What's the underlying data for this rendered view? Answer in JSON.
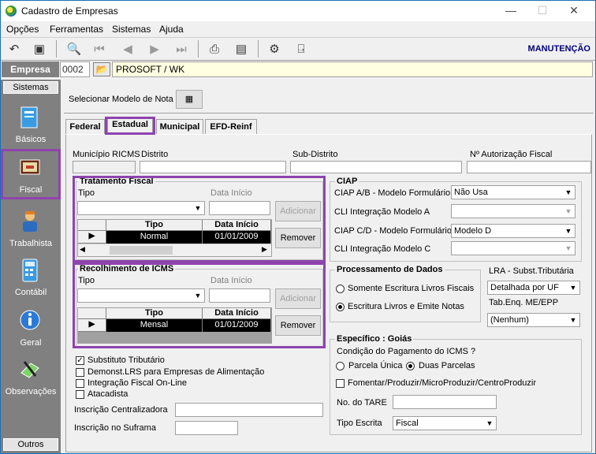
{
  "window": {
    "title": "Cadastro de Empresas",
    "minimize": "—",
    "maximize": "☐",
    "close": "✕"
  },
  "menu": [
    "Opções",
    "Ferramentas",
    "Sistemas",
    "Ajuda"
  ],
  "toolbar": {
    "mode_label": "MANUTENÇÃO"
  },
  "empresa": {
    "label": "Empresa",
    "code": "0002",
    "name": "PROSOFT / WK"
  },
  "sidebar": {
    "header": "Sistemas",
    "items": [
      {
        "label": "Básicos",
        "icon": "book-icon"
      },
      {
        "label": "Fiscal",
        "icon": "fiscal-book-icon"
      },
      {
        "label": "Trabalhista",
        "icon": "worker-icon"
      },
      {
        "label": "Contábil",
        "icon": "calculator-icon"
      },
      {
        "label": "Geral",
        "icon": "info-globe-icon"
      },
      {
        "label": "Observações",
        "icon": "notepad-pen-icon"
      }
    ],
    "footer": "Outros"
  },
  "modelo": {
    "label": "Selecionar Modelo de Nota"
  },
  "tabs": [
    "Federal",
    "Estadual",
    "Municipal",
    "EFD-Reinf"
  ],
  "fields": {
    "municipio_ricms": "Município RICMS",
    "distrito": "Distrito",
    "sub_distrito": "Sub-Distrito",
    "autorizacao": "Nº Autorização Fiscal"
  },
  "tratamento": {
    "title": "Tratamento Fiscal",
    "tipo_label": "Tipo",
    "data_label": "Data Início",
    "add_button": "Adicionar",
    "remove_button": "Remover",
    "columns": [
      "Tipo",
      "Data Início"
    ],
    "rows": [
      {
        "tipo": "Normal",
        "data": "01/01/2009"
      }
    ]
  },
  "recolhimento": {
    "title": "Recolhimento de ICMS",
    "tipo_label": "Tipo",
    "data_label": "Data Início",
    "add_button": "Adicionar",
    "remove_button": "Remover",
    "columns": [
      "Tipo",
      "Data Início"
    ],
    "rows": [
      {
        "tipo": "Mensal",
        "data": "01/01/2009"
      }
    ]
  },
  "checks": [
    {
      "label": "Substituto Tributário",
      "checked": true
    },
    {
      "label": "Demonst.LRS para Empresas de Alimentação",
      "checked": false
    },
    {
      "label": "Integração Fiscal On-Line",
      "checked": false
    },
    {
      "label": "Atacadista",
      "checked": false
    }
  ],
  "inscricao_centralizadora": "Inscrição Centralizadora",
  "inscricao_suframa": "Inscrição no Suframa",
  "ciap": {
    "title": "CIAP",
    "rows": [
      {
        "label": "CIAP  A/B - Modelo Formulário",
        "value": "Não Usa",
        "enabled": true
      },
      {
        "label": "CLI Integração Modelo A",
        "value": "",
        "enabled": false
      },
      {
        "label": "CIAP C/D - Modelo Formulário",
        "value": "Modelo D",
        "enabled": true
      },
      {
        "label": "CLI Integração Modelo C",
        "value": "",
        "enabled": false
      }
    ]
  },
  "processamento": {
    "title": "Processamento de Dados",
    "options": [
      {
        "label": "Somente Escritura Livros Fiscais",
        "selected": false
      },
      {
        "label": "Escritura Livros e Emite Notas",
        "selected": true
      }
    ]
  },
  "lra": {
    "label": "LRA - Subst.Tributária",
    "value": "Detalhada por UF"
  },
  "tabenq": {
    "label": "Tab.Enq. ME/EPP",
    "value": "(Nenhum)"
  },
  "goias": {
    "title": "Específico : Goiás",
    "condicao": "Condição do Pagamento do ICMS ?",
    "parcela_unica": "Parcela Única",
    "duas_parcelas": "Duas Parcelas",
    "fomentar": "Fomentar/Produzir/MicroProduzir/CentroProduzir",
    "tare": "No. do TARE",
    "tipo_escrita": "Tipo Escrita",
    "tipo_escrita_value": "Fiscal"
  }
}
